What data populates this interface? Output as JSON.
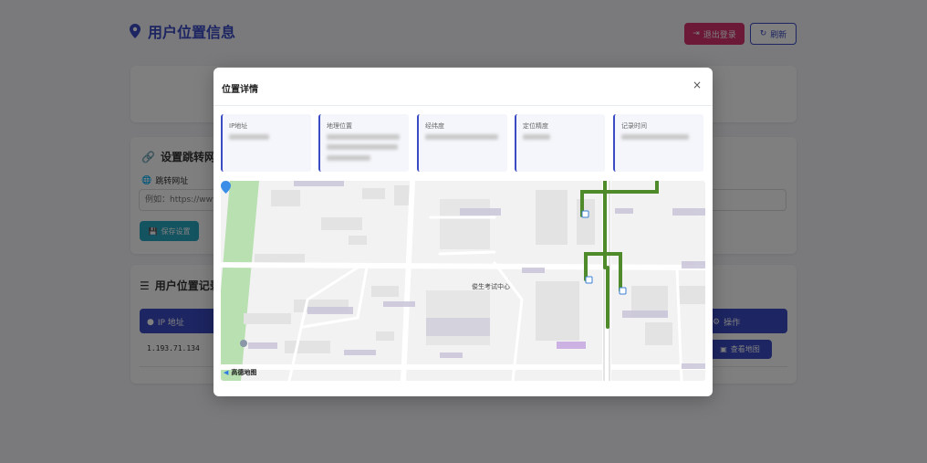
{
  "page": {
    "title": "用户位置信息",
    "logout_label": "退出登录",
    "refresh_label": "刷新"
  },
  "redirect_card": {
    "heading": "设置跳转网址",
    "field_label": "跳转网址",
    "input_placeholder": "例如：https://www.",
    "save_label": "保存设置"
  },
  "records_card": {
    "heading": "用户位置记录",
    "col_ip": "IP 地址",
    "col_ops": "操作",
    "rows": [
      {
        "ip": "1.193.71.134",
        "action_label": "查看地图"
      }
    ]
  },
  "modal": {
    "title": "位置详情",
    "close_label": "×",
    "info_cards": [
      {
        "label": "IP地址"
      },
      {
        "label": "地理位置"
      },
      {
        "label": "经纬度"
      },
      {
        "label": "定位精度"
      },
      {
        "label": "记录时间"
      }
    ],
    "map": {
      "marker_label": "俊生考试中心",
      "logo_text": "高德地图"
    }
  },
  "colors": {
    "primary": "#3a4bc4",
    "danger": "#d6336c",
    "info": "#29a8c2",
    "overlay": "rgba(0,0,0,0.5)"
  }
}
